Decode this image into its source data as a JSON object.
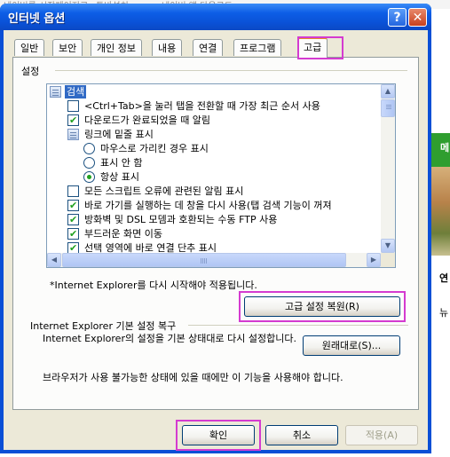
{
  "background_page": {
    "top_links": [
      "네이버를 시작페이지로",
      "투바설치",
      "네이버 앱 다운로드"
    ],
    "side_green_text": "메",
    "side_texts": [
      "연",
      "뉴"
    ]
  },
  "window": {
    "title": "인터넷 옵션",
    "help_glyph": "?",
    "close_glyph": "✕"
  },
  "tabs": [
    {
      "label": "일반",
      "active": false
    },
    {
      "label": "보안",
      "active": false
    },
    {
      "label": "개인 정보",
      "active": false
    },
    {
      "label": "내용",
      "active": false
    },
    {
      "label": "연결",
      "active": false
    },
    {
      "label": "프로그램",
      "active": false
    },
    {
      "label": "고급",
      "active": true
    }
  ],
  "settings": {
    "group_label": "설정",
    "items": [
      {
        "type": "folder",
        "label": "검색",
        "selected": true,
        "icon": "list-folder-icon"
      },
      {
        "type": "checkbox",
        "label": "<Ctrl+Tab>을 눌러 탭을 전환할 때 가장 최근 순서 사용",
        "checked": false
      },
      {
        "type": "checkbox",
        "label": "다운로드가 완료되었을 때 알림",
        "checked": true
      },
      {
        "type": "folder",
        "label": "링크에 밑줄 표시",
        "selected": false,
        "icon": "list-folder-icon"
      },
      {
        "type": "radio",
        "label": "마우스로 가리킨 경우 표시",
        "checked": false
      },
      {
        "type": "radio",
        "label": "표시 안 함",
        "checked": false
      },
      {
        "type": "radio",
        "label": "항상 표시",
        "checked": true
      },
      {
        "type": "checkbox",
        "label": "모든 스크립트 오류에 관련된 알림 표시",
        "checked": false
      },
      {
        "type": "checkbox",
        "label": "바로 가기를 실행하는 데 창을 다시 사용(탭 검색 기능이 꺼져",
        "checked": true
      },
      {
        "type": "checkbox",
        "label": "방화벽 및 DSL 모뎀과 호환되는 수동 FTP 사용",
        "checked": true
      },
      {
        "type": "checkbox",
        "label": "부드러운 화면 이동",
        "checked": true
      },
      {
        "type": "checkbox",
        "label": "선택 영역에 바로 연결 단추 표시",
        "checked": true
      }
    ],
    "restart_note": "*Internet Explorer를 다시 시작해야 적용됩니다.",
    "restore_advanced_button": "고급 설정 복원(R)"
  },
  "reset_section": {
    "label": "Internet Explorer 기본 설정 복구",
    "description": "Internet Explorer의 설정을 기본 상태대로 다시 설정합니다.",
    "reset_button": "원래대로(S)...",
    "note": "브라우저가 사용 불가능한 상태에 있을 때에만 이 기능을 사용해야 합니다."
  },
  "footer": {
    "ok": "확인",
    "cancel": "취소",
    "apply": "적용(A)",
    "apply_enabled": false
  },
  "highlight_color": "#d43bd0",
  "accent_colors": {
    "titlebar": "#0a52d8",
    "selection": "#316ac5",
    "check_green": "#21a121"
  }
}
